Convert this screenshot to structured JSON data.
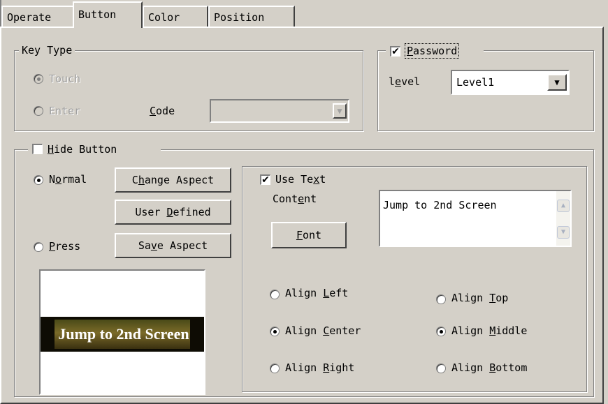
{
  "tabs": [
    {
      "label": "Operate",
      "active": false
    },
    {
      "label": "Button",
      "active": true
    },
    {
      "label": "Color",
      "active": false
    },
    {
      "label": "Position",
      "active": false
    }
  ],
  "key_type": {
    "legend": "Key Type",
    "touch_label": "Touch",
    "enter_label": "Enter",
    "code_label_u": "C",
    "code_label_rest": "ode",
    "code_value": "",
    "selected": "Touch",
    "enabled": false
  },
  "password": {
    "checked": true,
    "label_u": "P",
    "label_rest": "assword",
    "level_label_a": "l",
    "level_label_u": "e",
    "level_label_rest": "vel",
    "level_value": "Level1"
  },
  "hide_button": {
    "checked": false,
    "label_u": "H",
    "label_rest": "ide Button"
  },
  "state": {
    "normal_a": "N",
    "normal_u": "o",
    "normal_rest": "rmal",
    "press_u": "P",
    "press_rest": "ress",
    "selected": "Normal"
  },
  "buttons": {
    "change_aspect_a": "C",
    "change_aspect_u": "h",
    "change_aspect_rest": "ange Aspect",
    "user_defined_a": "User ",
    "user_defined_u": "D",
    "user_defined_rest": "efined",
    "save_aspect_a": "Sa",
    "save_aspect_u": "v",
    "save_aspect_rest": "e Aspect",
    "font_u": "F",
    "font_rest": "ont"
  },
  "preview": {
    "text": "Jump to 2nd Screen"
  },
  "text_settings": {
    "use_text_checked": true,
    "use_text_a": "Use Te",
    "use_text_u": "x",
    "use_text_rest": "t",
    "content_a": "Cont",
    "content_u": "e",
    "content_rest": "nt",
    "content_value": "Jump to 2nd Screen"
  },
  "alignment": {
    "horizontal_selected": "Center",
    "vertical_selected": "Middle",
    "align_left_a": "Align ",
    "align_left_u": "L",
    "align_left_rest": "eft",
    "align_center_a": "Align ",
    "align_center_u": "C",
    "align_center_rest": "enter",
    "align_right_a": "Align ",
    "align_right_u": "R",
    "align_right_rest": "ight",
    "align_top_a": "Align ",
    "align_top_u": "T",
    "align_top_rest": "op",
    "align_middle_a": "Align ",
    "align_middle_u": "M",
    "align_middle_rest": "iddle",
    "align_bottom_a": "Align ",
    "align_bottom_u": "B",
    "align_bottom_rest": "ottom"
  }
}
